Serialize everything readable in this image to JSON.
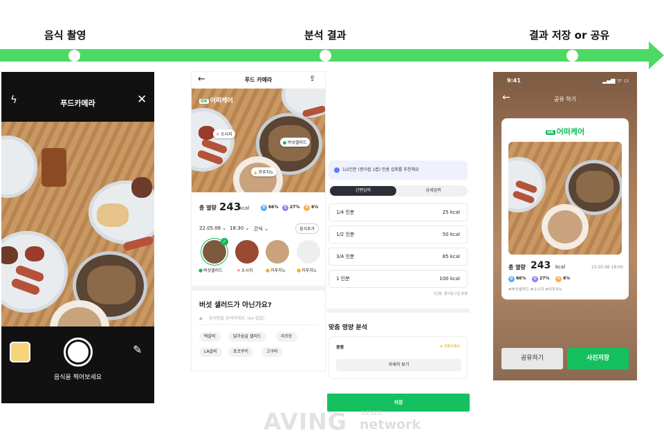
{
  "steps": [
    "음식 촬영",
    "분석 결과",
    "결과 저장 or 공유"
  ],
  "camera": {
    "title": "푸드카메라",
    "flash_icon": "flash-off-icon",
    "close_icon": "close-icon",
    "hint": "음식을 찍어보세요",
    "edit_icon": "pencil-icon"
  },
  "analysis": {
    "title": "푸드 카메라",
    "logo": "어떠케어",
    "photo_tags": [
      "소시지",
      "버섯샐러드",
      "카푸치노"
    ],
    "calorie_label": "총 열량",
    "calorie_value": "243",
    "calorie_unit": "kcal",
    "macros": [
      {
        "icon": "탄",
        "pct": "66%",
        "color": "#4dabf7"
      },
      {
        "icon": "단",
        "pct": "27%",
        "color": "#9775fa"
      },
      {
        "icon": "지",
        "pct": "6%",
        "color": "#ffa94d"
      }
    ],
    "date": "22.05.06",
    "time": "18:30",
    "meal": "간식",
    "add_button": "음식추가",
    "foods": [
      {
        "name": "버섯샐러드",
        "mark": "●",
        "color": "#14b85a"
      },
      {
        "name": "소시지",
        "mark": "×",
        "color": "#e03131"
      },
      {
        "name": "카푸치노",
        "mark": "●",
        "color": "#fab005"
      },
      {
        "name": "카푸치노",
        "mark": "●",
        "color": "#fab005"
      }
    ],
    "question": "버섯 샐러드가 아닌가요?",
    "search_placeholder": "음식명을 검색하세요. (ex 갈밥)",
    "chips": [
      "떡갈비",
      "닭가슴살 샐러드",
      "리조또",
      "LA갈비",
      "초코쿠키",
      "고구마"
    ]
  },
  "portion": {
    "note": "1/2인분 (종이컵 1컵) 만큼 섭취를 추천해요",
    "tab_simple": "간편입력",
    "tab_detail": "상세입력",
    "rows": [
      {
        "label": "1/4 인분",
        "kcal": "25 kcal"
      },
      {
        "label": "1/2 인분",
        "kcal": "50 kcal"
      },
      {
        "label": "3/4 인분",
        "kcal": "85 kcal"
      },
      {
        "label": "1 인분",
        "kcal": "100 kcal"
      }
    ],
    "fine_print": "1인분: 종이컵 2컵 분량",
    "section_title": "맞춤 영양 분석",
    "card_title": "총평",
    "card_status": "★ 보통이에요",
    "card_button": "자세히 보기",
    "save_button": "저장"
  },
  "share": {
    "time": "9:41",
    "status_icons": "▂▄▆ ᯤ ▭",
    "title": "공유 하기",
    "logo": "어떠케어",
    "calorie_label": "총 열량",
    "calorie_value": "243",
    "calorie_unit": "kcal",
    "date": "23.05.06 18:00",
    "macros": [
      {
        "icon": "탄",
        "pct": "66%",
        "color": "#4dabf7"
      },
      {
        "icon": "단",
        "pct": "27%",
        "color": "#9775fa"
      },
      {
        "icon": "지",
        "pct": "6%",
        "color": "#ffa94d"
      }
    ],
    "hashtags": "#버섯샐러드  #소시지  #카푸치노",
    "share_button": "공유하기",
    "save_button": "사진저장"
  },
  "watermark": {
    "main": "AVING",
    "sub1": "NEWS",
    "sub2": "network"
  },
  "colors": {
    "accent": "#14c060",
    "arrow": "#4cd964"
  }
}
